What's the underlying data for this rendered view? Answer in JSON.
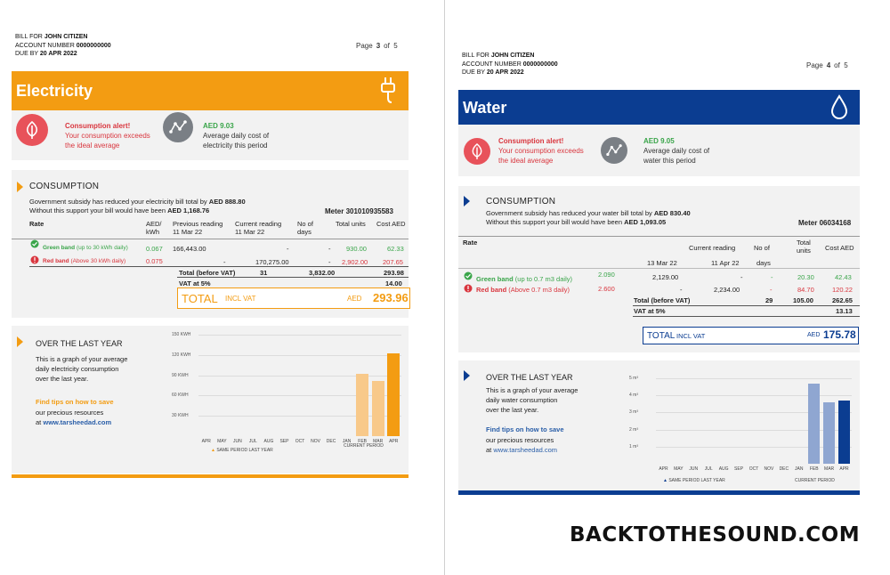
{
  "common": {
    "bill_for_label": "BILL FOR",
    "customer_name": "JOHN CITIZEN",
    "account_label": "ACCOUNT NUMBER",
    "account_number": "0000000000",
    "due_label": "DUE BY",
    "due_date": "20 APR 2022",
    "page_label": "Page",
    "of_label": "of",
    "total_pages": "5"
  },
  "electricity": {
    "page_number": "3",
    "title": "Electricity",
    "alert_title": "Consumption alert!",
    "alert_line1": "Your consumption exceeds",
    "alert_line2": "the ideal average",
    "avg_value": "AED 9.03",
    "avg_line1": "Average daily cost of",
    "avg_line2": "electricity this period",
    "section_title": "CONSUMPTION",
    "subsidy_line1": "Government subsidy has reduced your electricity bill total by",
    "subsidy_amount": "AED 888.80",
    "subsidy_line2": "Without this support your bill would have been",
    "without_amount": "AED 1,168.76",
    "meter": "Meter 301010935583",
    "headers": {
      "rate": "Rate",
      "aed_kwh_1": "AED/",
      "aed_kwh_2": "kWh",
      "prev_1": "Previous reading",
      "prev_2": "11 Mar 22",
      "curr_1": "Current reading",
      "curr_2": "11 Mar 22",
      "days_1": "No of",
      "days_2": "days",
      "units": "Total units",
      "cost": "Cost AED"
    },
    "green_band": {
      "name": "Green band",
      "range": "(up to 30 kWh daily)",
      "rate": "0.067",
      "prev": "166,443.00",
      "curr": "-",
      "days": "-",
      "units": "930.00",
      "cost": "62.33"
    },
    "red_band": {
      "name": "Red band",
      "range": "(Above 30 kWh daily)",
      "rate": "0.075",
      "prev": "-",
      "curr": "170,275.00",
      "days": "-",
      "units": "2,902.00",
      "cost": "207.65"
    },
    "total_before_vat_label": "Total (before VAT)",
    "total_days": "31",
    "total_units": "3,832.00",
    "total_cost": "293.98",
    "vat_label": "VAT at 5%",
    "vat_value": "14.00",
    "total_label": "TOTAL",
    "incl_vat": "INCL VAT",
    "aed_label": "AED",
    "grand_total": "293.96",
    "over_title": "OVER THE LAST YEAR",
    "over_line1": "This is a graph of your average",
    "over_line2": "daily electricity consumption",
    "over_line3": "over the last year.",
    "tips_title": "Find tips on how to save",
    "tips_line1": "our precious resources",
    "tips_at": "at",
    "tips_url": "www.tarsheedad.com",
    "legend_same": "SAME PERIOD LAST YEAR",
    "legend_current": "CURRENT PERIOD",
    "colors": {
      "primary": "#f39c12",
      "light": "#f8c98a",
      "alert": "#e8525a",
      "green": "#3aa54a"
    }
  },
  "water": {
    "page_number": "4",
    "title": "Water",
    "alert_title": "Consumption alert!",
    "alert_line1": "Your consumption exceeds",
    "alert_line2": "the ideal average",
    "avg_value": "AED 9.05",
    "avg_line1": "Average daily cost of",
    "avg_line2": "water this period",
    "section_title": "CONSUMPTION",
    "subsidy_line1": "Government subsidy has reduced your water bill total by",
    "subsidy_amount": "AED 830.40",
    "subsidy_line2": "Without this support your bill would have been",
    "without_amount": "AED 1,093.05",
    "meter": "Meter 06034168",
    "headers": {
      "rate": "Rate",
      "curr": "Current reading",
      "days_1": "No of",
      "days_2": "days",
      "units_1": "Total",
      "units_2": "units",
      "cost": "Cost AED",
      "prev_date": "13 Mar 22",
      "curr_date": "11 Apr 22"
    },
    "green_band": {
      "name": "Green band",
      "range": "(up to 0.7 m3 daily)",
      "rate": "2.090",
      "prev": "2,129.00",
      "curr": "-",
      "days": "-",
      "units": "20.30",
      "cost": "42.43"
    },
    "red_band": {
      "name": "Red band",
      "range": "(Above 0.7 m3 daily)",
      "rate": "2.600",
      "prev": "-",
      "curr": "2,234.00",
      "days": "-",
      "units": "84.70",
      "cost": "120.22"
    },
    "total_before_vat_label": "Total (before VAT)",
    "total_days": "29",
    "total_units": "105.00",
    "total_cost": "262.65",
    "vat_label": "VAT at 5%",
    "vat_value": "13.13",
    "total_label": "TOTAL",
    "incl_vat": "INCL VAT",
    "aed_label": "AED",
    "grand_total": "175.78",
    "over_title": "OVER THE LAST YEAR",
    "over_line1": "This is a graph of your average",
    "over_line2": "daily water consumption",
    "over_line3": "over the last year.",
    "tips_title": "Find tips on how to save",
    "tips_line1": "our precious resources",
    "tips_at": "at",
    "tips_url": "www.tarsheedad.com",
    "legend_same": "SAME PERIOD LAST YEAR",
    "legend_current": "CURRENT PERIOD",
    "colors": {
      "primary": "#0b3d91",
      "light": "#8fa6d1",
      "alert": "#e8525a",
      "green": "#3aa54a"
    }
  },
  "chart_data": [
    {
      "type": "bar",
      "title": "",
      "categories": [
        "APR",
        "MAY",
        "JUN",
        "JUL",
        "AUG",
        "SEP",
        "OCT",
        "NOV",
        "DEC",
        "JAN",
        "FEB",
        "MAR",
        "APR"
      ],
      "y_ticks": [
        "30 KWH",
        "60 KWH",
        "90 KWH",
        "120 KWH",
        "150 KWH"
      ],
      "ylim": [
        0,
        150
      ],
      "series": [
        {
          "name": "SAME PERIOD LAST YEAR",
          "values": [
            0,
            0,
            0,
            0,
            0,
            0,
            0,
            0,
            0,
            0,
            92,
            82,
            0
          ]
        },
        {
          "name": "CURRENT PERIOD",
          "values": [
            0,
            0,
            0,
            0,
            0,
            0,
            0,
            0,
            0,
            0,
            0,
            0,
            122
          ]
        }
      ],
      "grid": true
    },
    {
      "type": "bar",
      "title": "",
      "categories": [
        "APR",
        "MAY",
        "JUN",
        "JUL",
        "AUG",
        "SEP",
        "OCT",
        "NOV",
        "DEC",
        "JAN",
        "FEB",
        "MAR",
        "APR"
      ],
      "y_ticks": [
        "1 m³",
        "2 m³",
        "3 m³",
        "4 m³",
        "5 m³"
      ],
      "ylim": [
        0,
        5
      ],
      "series": [
        {
          "name": "SAME PERIOD LAST YEAR",
          "values": [
            0,
            0,
            0,
            0,
            0,
            0,
            0,
            0,
            0,
            0,
            4.7,
            3.6,
            0
          ]
        },
        {
          "name": "CURRENT PERIOD",
          "values": [
            0,
            0,
            0,
            0,
            0,
            0,
            0,
            0,
            0,
            0,
            0,
            0,
            3.7
          ]
        }
      ],
      "grid": true
    }
  ]
}
